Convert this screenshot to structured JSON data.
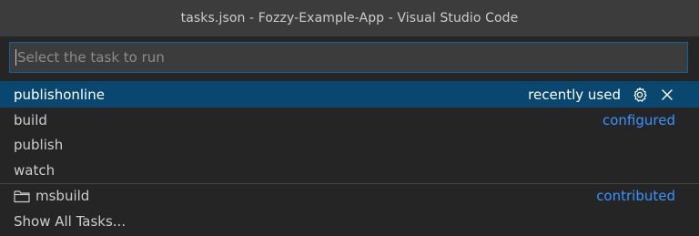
{
  "window": {
    "title": "tasks.json - Fozzy-Example-App - Visual Studio Code"
  },
  "picker": {
    "placeholder": "Select the task to run",
    "items": [
      {
        "label": "publishonline",
        "detail": "recently used",
        "selected": true
      },
      {
        "label": "build",
        "detail": "configured"
      },
      {
        "label": "publish",
        "detail": ""
      },
      {
        "label": "watch",
        "detail": ""
      },
      {
        "label": "msbuild",
        "detail": "contributed",
        "icon": "folder-icon"
      },
      {
        "label": "Show All Tasks...",
        "detail": ""
      }
    ]
  },
  "colors": {
    "titlebar_bg": "#3c3c3c",
    "panel_bg": "#252526",
    "selection_bg": "#094771",
    "focus_border": "#0e639c",
    "link_blue": "#3794ff"
  },
  "icons": {
    "configure": "gear-icon",
    "remove": "close-icon",
    "folder": "folder-icon"
  }
}
